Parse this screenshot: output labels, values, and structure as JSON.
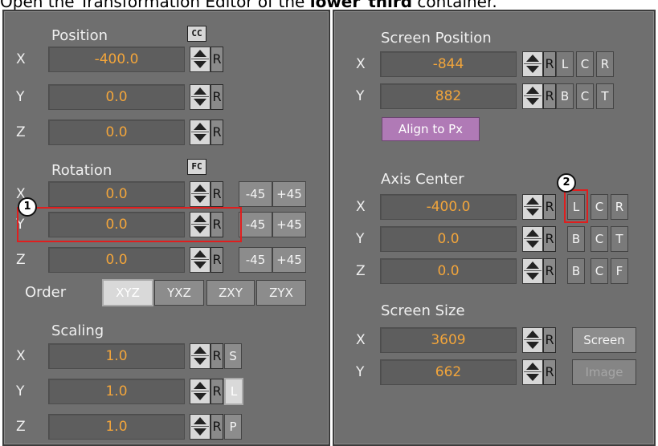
{
  "caption": {
    "prefix": "Open the Transformation Editor of the ",
    "bold": "lower_third",
    "suffix": " container."
  },
  "left": {
    "position": {
      "title": "Position",
      "tag": "CC",
      "rows": [
        {
          "axis": "X",
          "value": "-400.0"
        },
        {
          "axis": "Y",
          "value": "0.0"
        },
        {
          "axis": "Z",
          "value": "0.0"
        }
      ]
    },
    "rotation": {
      "title": "Rotation",
      "tag": "FC",
      "rows": [
        {
          "axis": "X",
          "value": "0.0"
        },
        {
          "axis": "Y",
          "value": "0.0"
        },
        {
          "axis": "Z",
          "value": "0.0"
        }
      ],
      "minus": "-45",
      "plus": "+45"
    },
    "order": {
      "label": "Order",
      "options": [
        "XYZ",
        "YXZ",
        "ZXY",
        "ZYX"
      ],
      "selected": "XYZ"
    },
    "scaling": {
      "title": "Scaling",
      "rows": [
        {
          "axis": "X",
          "value": "1.0",
          "btn": "S"
        },
        {
          "axis": "Y",
          "value": "1.0",
          "btn": "L"
        },
        {
          "axis": "Z",
          "value": "1.0",
          "btn": "P"
        }
      ]
    },
    "reset": "R"
  },
  "right": {
    "screen_position": {
      "title": "Screen Position",
      "rows": [
        {
          "axis": "X",
          "value": "-844",
          "btns": [
            "L",
            "C",
            "R"
          ]
        },
        {
          "axis": "Y",
          "value": "882",
          "btns": [
            "B",
            "C",
            "T"
          ]
        }
      ],
      "align": "Align to Px"
    },
    "axis_center": {
      "title": "Axis Center",
      "rows": [
        {
          "axis": "X",
          "value": "-400.0",
          "btns": [
            "L",
            "C",
            "R"
          ]
        },
        {
          "axis": "Y",
          "value": "0.0",
          "btns": [
            "B",
            "C",
            "T"
          ]
        },
        {
          "axis": "Z",
          "value": "0.0",
          "btns": [
            "B",
            "C",
            "F"
          ]
        }
      ]
    },
    "screen_size": {
      "title": "Screen Size",
      "rows": [
        {
          "axis": "X",
          "value": "3609",
          "btn": "Screen"
        },
        {
          "axis": "Y",
          "value": "662",
          "btn": "Image"
        }
      ]
    },
    "reset": "R"
  },
  "callouts": [
    "1",
    "2"
  ],
  "colors": {
    "panel": "#6f6f6f",
    "field": "#5e5e5e",
    "value": "#f2a53b",
    "highlight": "#e01e1e",
    "align": "#b07ab6"
  }
}
